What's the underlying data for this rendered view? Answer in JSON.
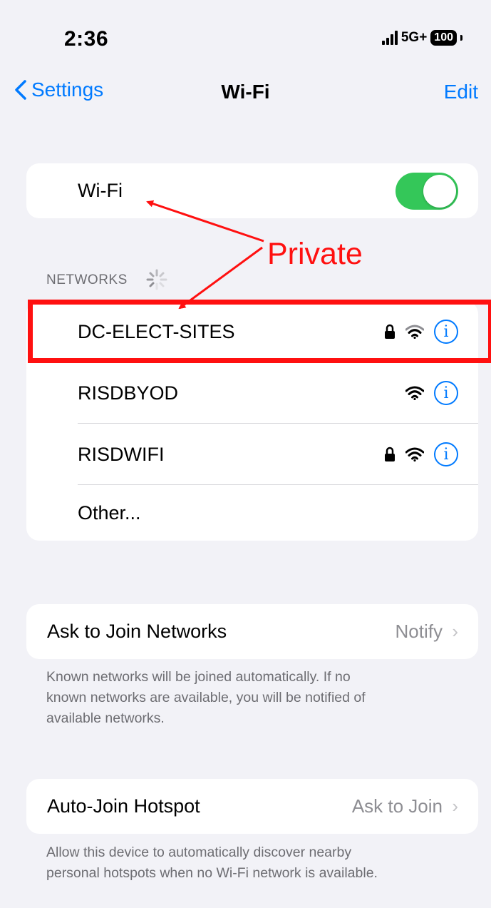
{
  "status_bar": {
    "time": "2:36",
    "network": "5G+",
    "battery": "100"
  },
  "nav": {
    "back_label": "Settings",
    "title": "Wi-Fi",
    "edit_label": "Edit"
  },
  "wifi_toggle": {
    "label": "Wi-Fi",
    "on": true,
    "color": "#34c759"
  },
  "networks_header": "NETWORKS",
  "networks": [
    {
      "name": "DC-ELECT-SITES",
      "locked": true
    },
    {
      "name": "RISDBYOD",
      "locked": false
    },
    {
      "name": "RISDWIFI",
      "locked": true
    }
  ],
  "other_label": "Other...",
  "ask_to_join": {
    "label": "Ask to Join Networks",
    "value": "Notify",
    "footnote_lines": [
      "Known networks will be joined automatically. If no",
      "known networks are available, you will be notified of",
      "available networks."
    ]
  },
  "auto_join": {
    "label": "Auto-Join Hotspot",
    "value": "Ask to Join",
    "footnote_lines": [
      "Allow this device to automatically discover nearby",
      "personal hotspots when no Wi-Fi network is available."
    ]
  },
  "annotation": {
    "text": "Private",
    "color": "#ff1010"
  },
  "accent_color": "#007aff"
}
